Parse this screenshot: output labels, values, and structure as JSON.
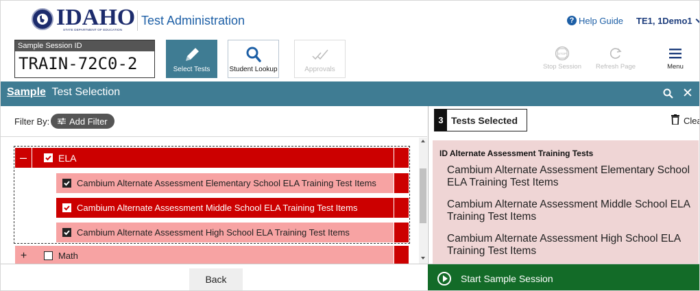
{
  "header": {
    "logo_text": "IDAHO",
    "logo_subtext": "STATE DEPARTMENT OF EDUCATION",
    "app_title": "Test Administration",
    "help_label": "Help Guide",
    "user_label": "TE1, 1Demo1"
  },
  "session": {
    "id_label": "Sample Session ID",
    "id_value": "TRAIN-72C0-2"
  },
  "toolbar": {
    "select_tests": "Select Tests",
    "student_lookup": "Student Lookup",
    "approvals": "Approvals",
    "stop_session": "Stop Session",
    "refresh_page": "Refresh Page",
    "menu": "Menu"
  },
  "title_bar": {
    "prefix": "Sample",
    "title": "Test Selection"
  },
  "filter": {
    "label": "Filter By:",
    "add_filter": "Add Filter"
  },
  "tree": {
    "ela": {
      "label": "ELA",
      "expanded": true,
      "checked": true
    },
    "ela_items": [
      {
        "label": "Cambium Alternate Assessment Elementary School ELA Training Test Items",
        "checked": true
      },
      {
        "label": "Cambium Alternate Assessment Middle School ELA Training Test Items",
        "checked": true
      },
      {
        "label": "Cambium Alternate Assessment High School ELA Training Test Items",
        "checked": true
      }
    ],
    "math": {
      "label": "Math",
      "expanded": false,
      "checked": false
    }
  },
  "selected": {
    "count": "3",
    "label": "Tests Selected",
    "clear_all": "Clear All",
    "group_title": "ID Alternate Assessment Training Tests",
    "items": [
      "Cambium Alternate Assessment Elementary School ELA Training Test Items",
      "Cambium Alternate Assessment Middle School ELA Training Test Items",
      "Cambium Alternate Assessment High School ELA Training Test Items"
    ]
  },
  "footer": {
    "back": "Back",
    "start": "Start Sample Session"
  },
  "colors": {
    "teal": "#3f7c93",
    "red": "#cc0000",
    "pink": "#f7a3a3",
    "panel_pink": "#efd5d5",
    "green": "#136b28",
    "navy": "#1c2b6c"
  }
}
